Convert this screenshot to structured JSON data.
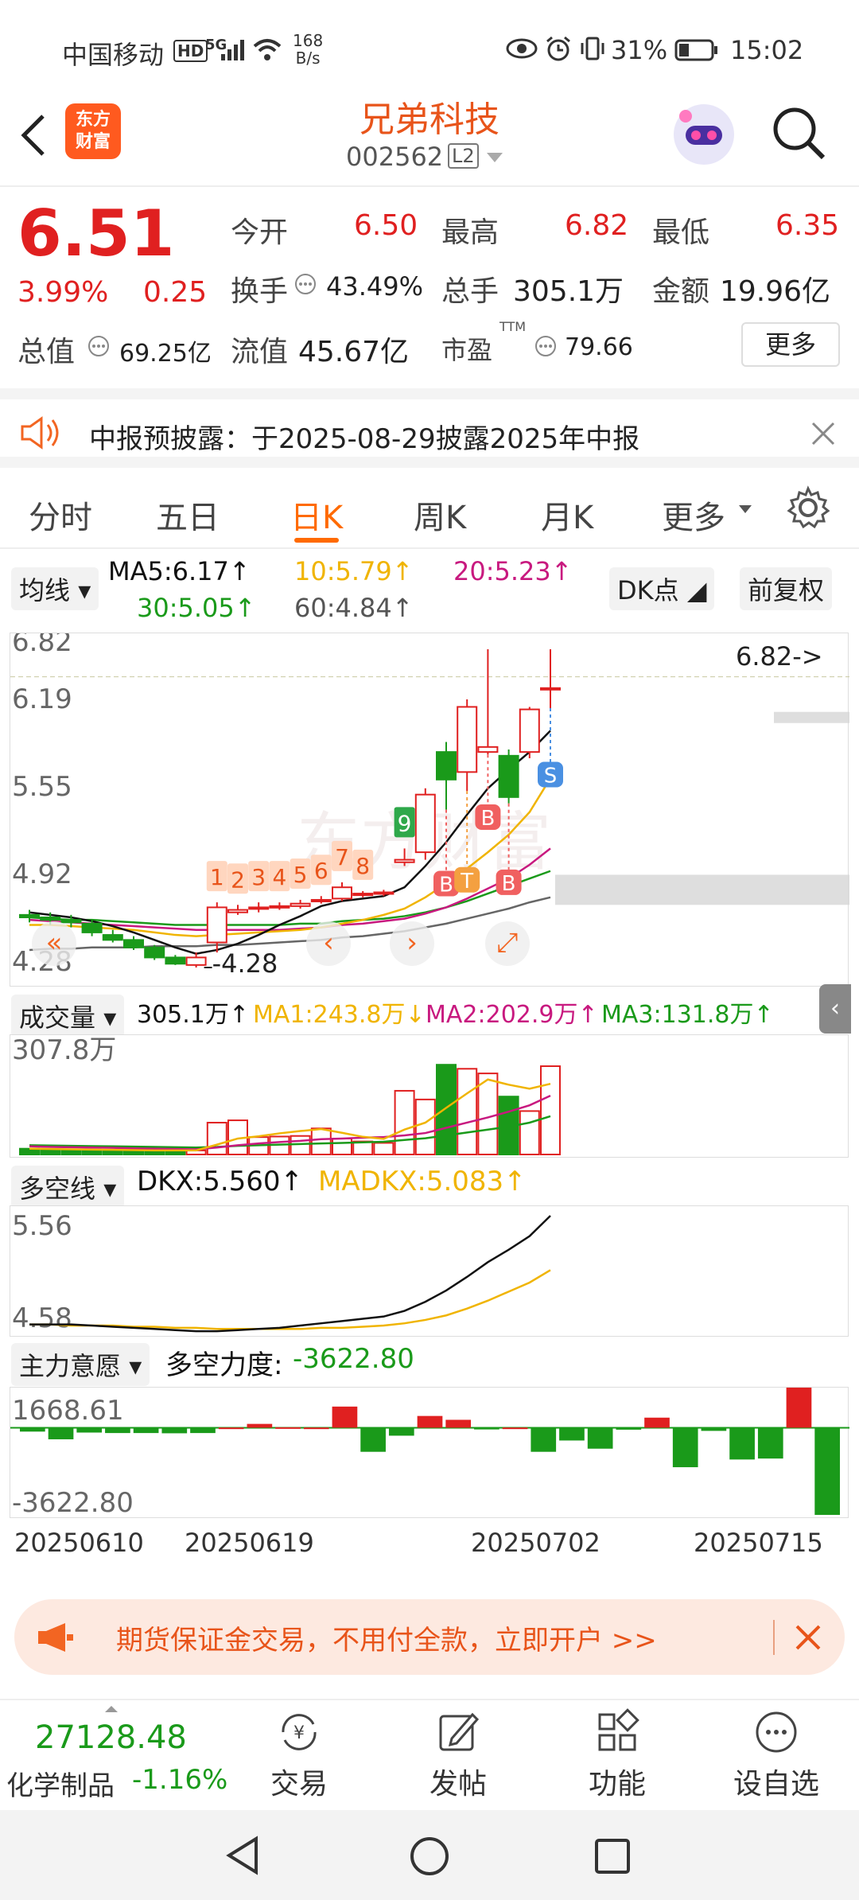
{
  "status_bar": {
    "carrier": "中国移动",
    "hd": "HD",
    "network": "5G",
    "speed_value": "168",
    "speed_unit": "B/s",
    "battery": "31%",
    "time": "15:02"
  },
  "header": {
    "logo_text_line1": "东方",
    "logo_text_line2": "财富",
    "stock_name": "兄弟科技",
    "stock_code": "002562",
    "level": "L2"
  },
  "quote": {
    "price": "6.51",
    "change_pct": "3.99%",
    "change_amt": "0.25",
    "open_label": "今开",
    "open_value": "6.50",
    "high_label": "最高",
    "high_value": "6.82",
    "low_label": "最低",
    "low_value": "6.35",
    "turnover_label": "换手",
    "turnover_value": "43.49%",
    "volume_label": "总手",
    "volume_value": "305.1万",
    "amount_label": "金额",
    "amount_value": "19.96亿",
    "mktcap_label": "总值",
    "mktcap_value": "69.25亿",
    "float_label": "流值",
    "float_value": "45.67亿",
    "pe_label": "市盈",
    "pe_sup": "TTM",
    "pe_value": "79.66",
    "more_button": "更多"
  },
  "notice": {
    "text": "中报预披露：于2025-08-29披露2025年中报"
  },
  "tabs": {
    "items": [
      "分时",
      "五日",
      "日K",
      "周K",
      "月K",
      "更多"
    ],
    "active_index": 2
  },
  "kline_header": {
    "selector": "均线",
    "ma5": "MA5:6.17↑",
    "ma10": "10:5.79↑",
    "ma20": "20:5.23↑",
    "ma30": "30:5.05↑",
    "ma60": "60:4.84↑",
    "dk_button": "DK点",
    "fq_button": "前复权"
  },
  "kline": {
    "y_labels": [
      "6.82",
      "6.19",
      "5.55",
      "4.92",
      "4.28"
    ],
    "high_marker": "6.82->",
    "low_marker": "4.28",
    "watermark": "东方财富",
    "count_labels": [
      "1",
      "2",
      "3",
      "4",
      "5",
      "6",
      "7",
      "8",
      "9"
    ],
    "signals": [
      {
        "label": "B"
      },
      {
        "label": "T"
      },
      {
        "label": "B"
      },
      {
        "label": "B"
      },
      {
        "label": "S"
      }
    ],
    "candles": [
      {
        "o": 4.7,
        "c": 4.68,
        "h": 4.74,
        "l": 4.64
      },
      {
        "o": 4.68,
        "c": 4.66,
        "h": 4.72,
        "l": 4.62
      },
      {
        "o": 4.66,
        "c": 4.64,
        "h": 4.7,
        "l": 4.6
      },
      {
        "o": 4.63,
        "c": 4.56,
        "h": 4.66,
        "l": 4.53
      },
      {
        "o": 4.54,
        "c": 4.5,
        "h": 4.58,
        "l": 4.48
      },
      {
        "o": 4.5,
        "c": 4.44,
        "h": 4.53,
        "l": 4.42
      },
      {
        "o": 4.44,
        "c": 4.36,
        "h": 4.46,
        "l": 4.34
      },
      {
        "o": 4.36,
        "c": 4.31,
        "h": 4.38,
        "l": 4.3
      },
      {
        "o": 4.3,
        "c": 4.36,
        "h": 4.4,
        "l": 4.28
      },
      {
        "o": 4.48,
        "c": 4.76,
        "h": 4.8,
        "l": 4.4
      },
      {
        "o": 4.72,
        "c": 4.74,
        "h": 4.78,
        "l": 4.7
      },
      {
        "o": 4.75,
        "c": 4.76,
        "h": 4.8,
        "l": 4.72
      },
      {
        "o": 4.76,
        "c": 4.77,
        "h": 4.8,
        "l": 4.74
      },
      {
        "o": 4.77,
        "c": 4.79,
        "h": 4.82,
        "l": 4.75
      },
      {
        "o": 4.81,
        "c": 4.82,
        "h": 4.85,
        "l": 4.79
      },
      {
        "o": 4.83,
        "c": 4.92,
        "h": 4.96,
        "l": 4.81
      },
      {
        "o": 4.87,
        "c": 4.87,
        "h": 4.89,
        "l": 4.84
      },
      {
        "o": 4.88,
        "c": 4.88,
        "h": 4.9,
        "l": 4.85
      },
      {
        "o": 5.12,
        "c": 5.14,
        "h": 5.23,
        "l": 5.09
      },
      {
        "o": 5.2,
        "c": 5.66,
        "h": 5.71,
        "l": 5.14
      },
      {
        "o": 6.0,
        "c": 5.78,
        "h": 6.08,
        "l": 5.54
      },
      {
        "o": 5.84,
        "c": 6.36,
        "h": 6.42,
        "l": 5.69
      },
      {
        "o": 6.0,
        "c": 6.04,
        "h": 6.82,
        "l": 5.98
      },
      {
        "o": 5.97,
        "c": 5.64,
        "h": 6.02,
        "l": 5.59
      },
      {
        "o": 6.0,
        "c": 6.34,
        "h": 6.36,
        "l": 5.95
      },
      {
        "o": 6.5,
        "c": 6.51,
        "h": 6.82,
        "l": 6.35
      }
    ],
    "ma5_line": [
      4.72,
      4.7,
      4.68,
      4.65,
      4.61,
      4.56,
      4.5,
      4.44,
      4.39,
      4.42,
      4.47,
      4.54,
      4.62,
      4.69,
      4.77,
      4.81,
      4.83,
      4.85,
      4.92,
      5.09,
      5.28,
      5.5,
      5.71,
      5.86,
      6.0,
      6.17
    ],
    "ma10_line": [
      4.62,
      4.62,
      4.61,
      4.6,
      4.59,
      4.58,
      4.56,
      4.54,
      4.53,
      4.54,
      4.55,
      4.56,
      4.57,
      4.58,
      4.6,
      4.63,
      4.66,
      4.7,
      4.75,
      4.84,
      4.95,
      5.07,
      5.2,
      5.34,
      5.52,
      5.79
    ],
    "ma20_line": [
      4.66,
      4.65,
      4.64,
      4.63,
      4.62,
      4.61,
      4.6,
      4.59,
      4.58,
      4.58,
      4.58,
      4.58,
      4.58,
      4.59,
      4.6,
      4.62,
      4.63,
      4.65,
      4.67,
      4.71,
      4.76,
      4.83,
      4.91,
      4.99,
      5.1,
      5.23
    ],
    "ma30_line": [
      4.68,
      4.67,
      4.66,
      4.66,
      4.65,
      4.64,
      4.63,
      4.62,
      4.62,
      4.62,
      4.62,
      4.62,
      4.62,
      4.63,
      4.63,
      4.65,
      4.66,
      4.67,
      4.69,
      4.72,
      4.76,
      4.81,
      4.87,
      4.93,
      4.99,
      5.05
    ],
    "ma60_line": [
      4.42,
      4.43,
      4.43,
      4.44,
      4.44,
      4.44,
      4.45,
      4.45,
      4.45,
      4.46,
      4.46,
      4.47,
      4.48,
      4.49,
      4.5,
      4.52,
      4.53,
      4.55,
      4.57,
      4.6,
      4.63,
      4.67,
      4.71,
      4.75,
      4.8,
      4.84
    ],
    "ylim": [
      4.28,
      6.82
    ]
  },
  "volume": {
    "selector": "成交量",
    "value": "305.1万↑",
    "ma1": "MA1:243.8万↓",
    "ma2": "MA2:202.9万↑",
    "ma3": "MA3:131.8万↑",
    "y_label": "307.8万",
    "bars": [
      20,
      18,
      17,
      15,
      15,
      13,
      13,
      14,
      14,
      110,
      118,
      60,
      62,
      64,
      90,
      55,
      45,
      40,
      220,
      190,
      310,
      296,
      280,
      200,
      150,
      305
    ],
    "ma1_line": [
      20,
      19,
      18,
      17,
      16,
      15,
      14,
      14,
      14,
      34,
      55,
      63,
      73,
      81,
      88,
      75,
      61,
      54,
      86,
      110,
      161,
      211,
      259,
      241,
      227,
      244
    ],
    "ma2_line": [
      28,
      26,
      25,
      24,
      23,
      21,
      20,
      19,
      18,
      24,
      32,
      38,
      43,
      47,
      53,
      55,
      58,
      60,
      66,
      74,
      92,
      110,
      128,
      148,
      170,
      203
    ],
    "ma3_line": [
      32,
      31,
      30,
      29,
      28,
      27,
      26,
      25,
      24,
      26,
      30,
      32,
      34,
      36,
      38,
      40,
      42,
      44,
      50,
      56,
      66,
      76,
      86,
      96,
      110,
      132
    ],
    "ylim": [
      0,
      307.8
    ]
  },
  "dkx": {
    "selector": "多空线",
    "dkx": "DKX:5.560↑",
    "madkx": "MADKX:5.083↑",
    "y_labels": [
      "5.56",
      "4.58"
    ],
    "dkx_line": [
      4.6,
      4.6,
      4.6,
      4.59,
      4.58,
      4.57,
      4.56,
      4.55,
      4.54,
      4.54,
      4.55,
      4.56,
      4.57,
      4.59,
      4.61,
      4.63,
      4.65,
      4.67,
      4.72,
      4.8,
      4.9,
      5.02,
      5.15,
      5.26,
      5.38,
      5.56
    ],
    "madkx_line": [
      4.6,
      4.6,
      4.59,
      4.59,
      4.59,
      4.58,
      4.58,
      4.57,
      4.57,
      4.56,
      4.56,
      4.56,
      4.56,
      4.56,
      4.57,
      4.57,
      4.58,
      4.59,
      4.61,
      4.64,
      4.68,
      4.74,
      4.81,
      4.89,
      4.97,
      5.08
    ],
    "ylim": [
      4.52,
      5.56
    ]
  },
  "power": {
    "selector": "主力意愿",
    "label": "多空力度:",
    "value": "-3622.80",
    "y_labels": [
      "1668.61",
      "-3622.80"
    ],
    "bars": [
      -160,
      -480,
      -200,
      -220,
      -220,
      -230,
      -220,
      10,
      160,
      20,
      10,
      880,
      -1000,
      -330,
      490,
      330,
      -70,
      10,
      -1000,
      -530,
      -870,
      -80,
      420,
      -1640,
      -130,
      -1320,
      -1280,
      1668,
      -3622
    ],
    "ylim": [
      -3622.8,
      1668.61
    ]
  },
  "x_axis": [
    "20250610",
    "20250619",
    "20250702",
    "20250715"
  ],
  "ad": {
    "text": "期货保证金交易，不用付全款，立即开户 >>"
  },
  "bottom_nav": {
    "index_value": "27128.48",
    "index_name": "化学制品",
    "index_change": "-1.16%",
    "items": [
      "交易",
      "发帖",
      "功能",
      "设自选"
    ]
  },
  "colors": {
    "up": "#e02020",
    "down": "#1a9a1a",
    "accent": "#ff6a00",
    "ma5": "#111111",
    "ma10": "#f0b400",
    "ma20": "#c8197f",
    "ma30": "#1a9a1a",
    "ma60": "#666666"
  }
}
